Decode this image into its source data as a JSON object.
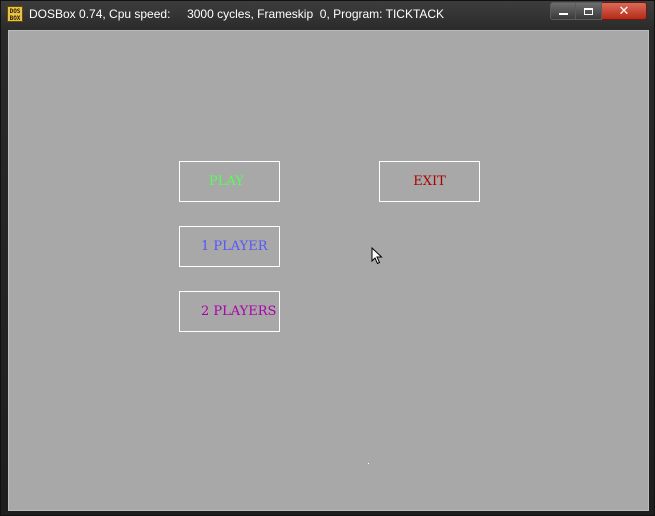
{
  "window": {
    "title": "DOSBox 0.74, Cpu speed:     3000 cycles, Frameskip  0, Program: TICKTACK",
    "icon_text": "DOS BOX",
    "minimize_icon": "minimize-icon",
    "maximize_icon": "maximize-icon",
    "close_icon": "close-icon",
    "close_glyph": "✕"
  },
  "menu": {
    "play_label": "PLAY",
    "exit_label": "EXIT",
    "one_player_label": "1 PLAYER",
    "two_players_label": "2 PLAYERS"
  },
  "colors": {
    "background": "#a8a8a8",
    "play": "#55ff55",
    "exit": "#aa0000",
    "one_player": "#5555ff",
    "two_players": "#aa00aa"
  }
}
